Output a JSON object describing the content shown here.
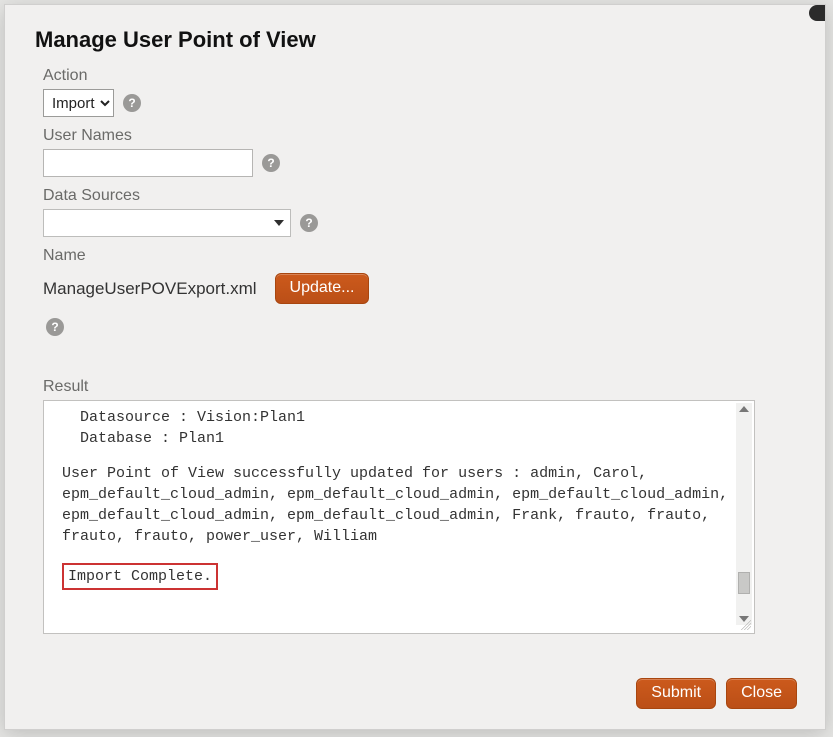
{
  "dialog": {
    "title": "Manage User Point of View"
  },
  "form": {
    "action_label": "Action",
    "action_value": "Import",
    "user_names_label": "User Names",
    "user_names_value": "",
    "data_sources_label": "Data Sources",
    "data_sources_value": "",
    "name_label": "Name",
    "name_value": "ManageUserPOVExport.xml",
    "update_label": "Update..."
  },
  "result": {
    "label": "Result",
    "top_lines": "  Datasource : Vision:Plan1\n  Database : Plan1",
    "body": "User Point of View successfully updated for users : admin, Carol, epm_default_cloud_admin, epm_default_cloud_admin, epm_default_cloud_admin, epm_default_cloud_admin, epm_default_cloud_admin, Frank, frauto, frauto, frauto, frauto, power_user, William",
    "highlight": "Import Complete."
  },
  "footer": {
    "submit_label": "Submit",
    "close_label": "Close"
  },
  "icons": {
    "help_glyph": "?"
  }
}
